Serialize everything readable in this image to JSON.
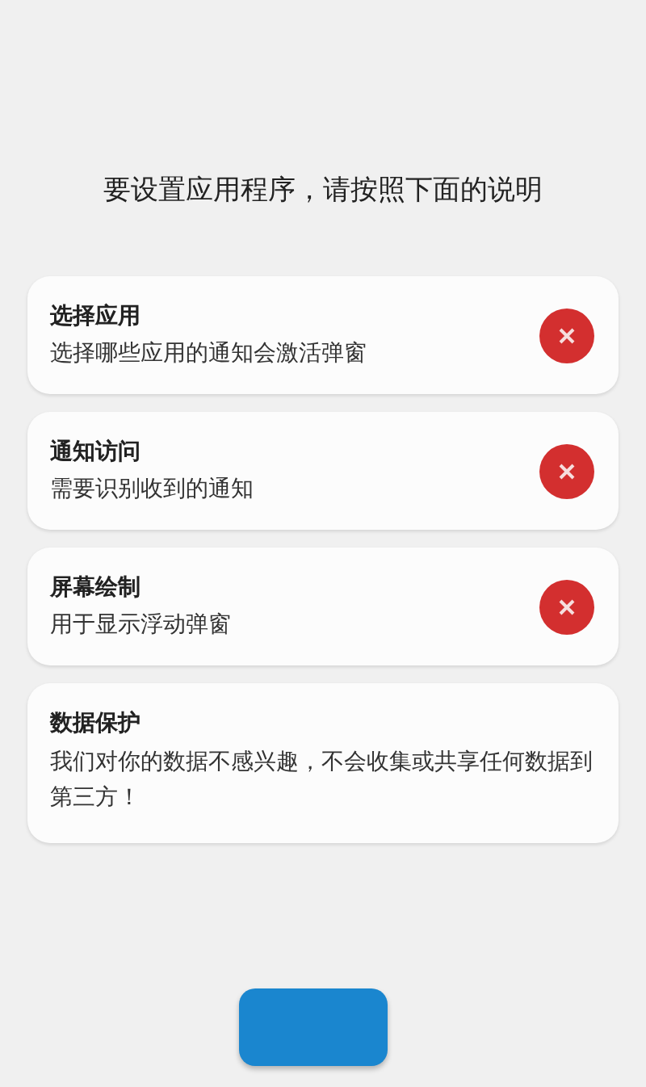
{
  "heading": "要设置应用程序，请按照下面的说明",
  "cards": [
    {
      "kind": "permission",
      "title": "选择应用",
      "description": "选择哪些应用的通知会激活弹窗",
      "granted": false
    },
    {
      "kind": "permission",
      "title": "通知访问",
      "description": "需要识别收到的通知",
      "granted": false
    },
    {
      "kind": "permission",
      "title": "屏幕绘制",
      "description": "用于显示浮动弹窗",
      "granted": false
    },
    {
      "kind": "info",
      "title": "数据保护",
      "description": "我们对你的数据不感兴趣，不会收集或共享任何数据到第三方！"
    }
  ],
  "action_button": {
    "kind": "primary"
  }
}
